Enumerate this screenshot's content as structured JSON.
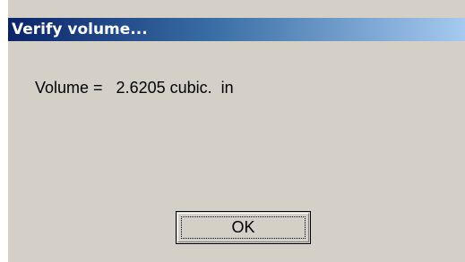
{
  "window": {
    "title": "Verify volume..."
  },
  "message": {
    "text": "Volume =   2.6205 cubic.  in"
  },
  "buttons": {
    "ok_label": "OK"
  },
  "colors": {
    "titlebar_start": "#0a246a",
    "titlebar_end": "#a6caf0",
    "dialog_background": "#d4d0c8"
  }
}
